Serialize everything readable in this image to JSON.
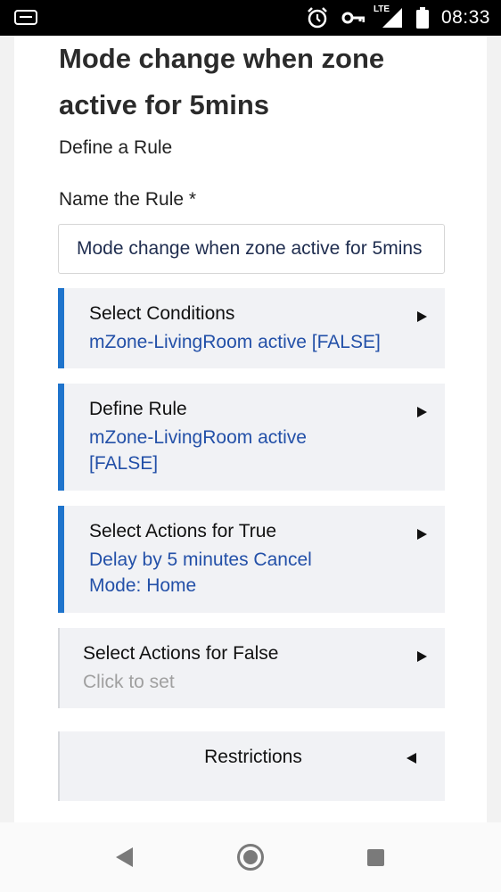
{
  "status_bar": {
    "time": "08:33",
    "icons": [
      "notification-icon",
      "alarm-icon",
      "vpn-key-icon",
      "lte-signal-icon",
      "battery-icon"
    ],
    "lte_label": "LTE"
  },
  "page": {
    "title": "Mode change when zone active for 5mins",
    "subtitle": "Define a Rule",
    "name_label": "Name the Rule *",
    "name_value": "Mode change when zone active for 5mins"
  },
  "sections": [
    {
      "title": "Select Conditions",
      "value": "mZone-LivingRoom active [FALSE]",
      "active": true
    },
    {
      "title": "Define Rule",
      "value": "mZone-LivingRoom active [FALSE]",
      "active": true
    },
    {
      "title": "Select Actions for True",
      "value": "Delay by 5 minutes Cancel Mode: Home",
      "active": true
    },
    {
      "title": "Select Actions for False",
      "value": "Click to set",
      "active": false
    }
  ],
  "restrictions": {
    "label": "Restrictions"
  },
  "colors": {
    "accent": "#1f74cc",
    "value_text": "#2350a8",
    "placeholder_text": "#a0a0a0",
    "section_bg": "#f1f2f5"
  }
}
